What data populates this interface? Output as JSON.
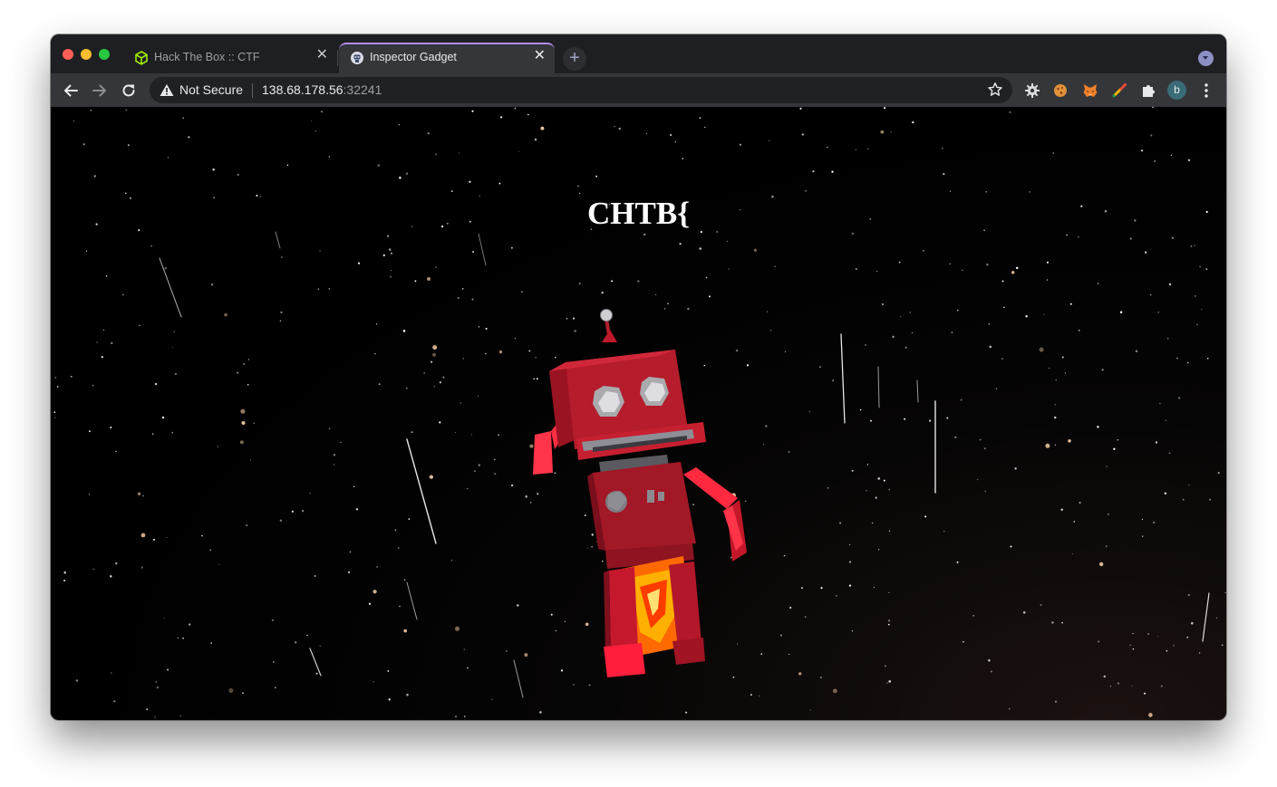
{
  "browser": {
    "tabs": [
      {
        "title": "Hack The Box :: CTF",
        "favicon": "hackthebox-cube-icon",
        "active": false
      },
      {
        "title": "Inspector Gadget",
        "favicon": "robot-favicon-icon",
        "active": true
      }
    ],
    "close_glyph": "✕",
    "new_tab_glyph": "+",
    "address_bar": {
      "security_label": "Not Secure",
      "url_host": "138.68.178.56",
      "url_port": ":32241"
    },
    "extensions": [
      "gear-extension-icon",
      "cookie-extension-icon",
      "metamask-fox-icon",
      "rocket-extension-icon",
      "puzzle-extensions-icon"
    ],
    "profile_initial": "b"
  },
  "page": {
    "flag_text": "CHTB{"
  },
  "colors": {
    "active_tab_accent": "#b58cf0",
    "robot_body": "#b01e2e",
    "page_background": "#000000"
  }
}
